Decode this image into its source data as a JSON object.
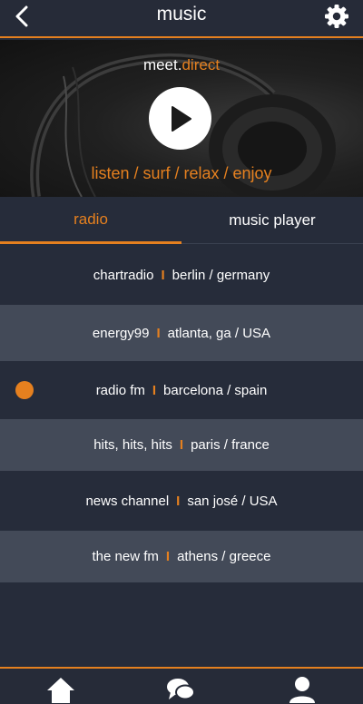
{
  "header": {
    "title": "music",
    "back_icon": "back-arrow-icon",
    "settings_icon": "gear-icon"
  },
  "hero": {
    "brand_prefix": "meet.",
    "brand_accent": "direct",
    "tagline": "listen / surf / relax / enjoy",
    "play_icon": "play-icon"
  },
  "tabs": [
    {
      "label": "radio",
      "active": true
    },
    {
      "label": "music player",
      "active": false
    }
  ],
  "stations": [
    {
      "name": "chartradio",
      "location": "berlin / germany",
      "active": false
    },
    {
      "name": "energy99",
      "location": "atlanta, ga / USA",
      "active": false
    },
    {
      "name": "radio fm",
      "location": "barcelona / spain",
      "active": true
    },
    {
      "name": "hits, hits, hits",
      "location": "paris / france",
      "active": false
    },
    {
      "name": "news channel",
      "location": "san josé / USA",
      "active": false
    },
    {
      "name": "the new fm",
      "location": "athens / greece",
      "active": false
    }
  ],
  "separator": "I",
  "bottom_nav": [
    {
      "icon": "home-icon"
    },
    {
      "icon": "chat-icon"
    },
    {
      "icon": "profile-icon"
    }
  ],
  "colors": {
    "accent": "#e5801f",
    "background": "#262c3a",
    "row_alt": "#434a58"
  }
}
